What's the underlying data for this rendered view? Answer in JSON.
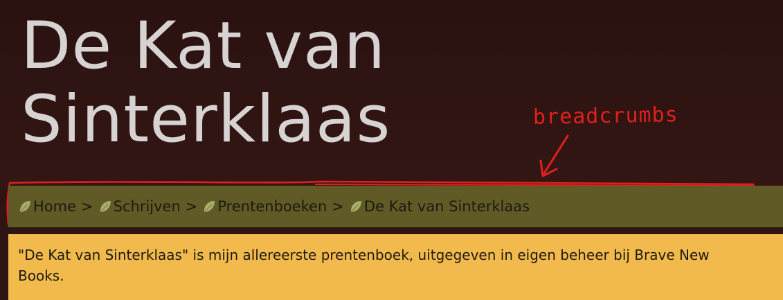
{
  "site": {
    "title": "De Kat van Sinterklaas"
  },
  "annotation": {
    "label": "breadcrumbs",
    "color": "#e0201c"
  },
  "breadcrumbs": {
    "items": [
      {
        "label": "Home",
        "icon": "leaf-icon"
      },
      {
        "label": "Schrijven",
        "icon": "leaf-icon"
      },
      {
        "label": "Prentenboeken",
        "icon": "leaf-icon"
      },
      {
        "label": "De Kat van Sinterklaas",
        "icon": "leaf-icon"
      }
    ],
    "separator": ">"
  },
  "content": {
    "intro": "\"De Kat van Sinterklaas\" is mijn allereerste prentenboek, uitgegeven in eigen beheer bij Brave New Books."
  },
  "colors": {
    "background": "#2e1412",
    "breadcrumb_bar": "#5f5a26",
    "content_box": "#f2ba4c",
    "title_text": "#d6d3d2",
    "leaf": "#a9ae6a"
  }
}
